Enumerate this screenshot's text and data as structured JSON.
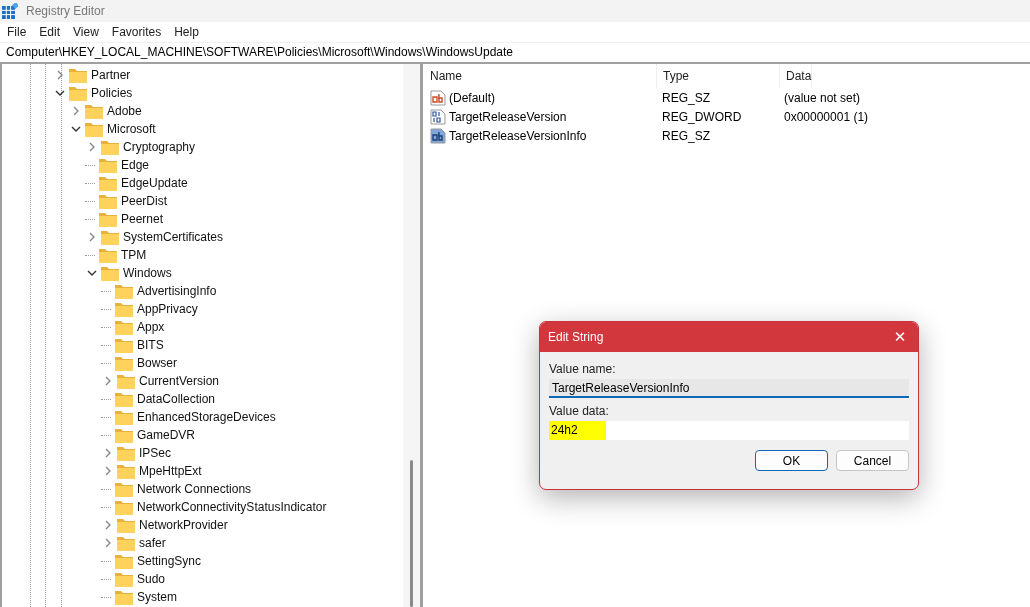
{
  "window": {
    "title": "Registry Editor"
  },
  "menu": [
    "File",
    "Edit",
    "View",
    "Favorites",
    "Help"
  ],
  "address": "Computer\\HKEY_LOCAL_MACHINE\\SOFTWARE\\Policies\\Microsoft\\Windows\\WindowsUpdate",
  "tree": [
    {
      "label": "Partner",
      "expanded": false
    },
    {
      "label": "Policies",
      "expanded": true,
      "children": [
        {
          "label": "Adobe",
          "expanded": false
        },
        {
          "label": "Microsoft",
          "expanded": true,
          "children": [
            {
              "label": "Cryptography",
              "expanded": false
            },
            {
              "label": "Edge"
            },
            {
              "label": "EdgeUpdate"
            },
            {
              "label": "PeerDist"
            },
            {
              "label": "Peernet"
            },
            {
              "label": "SystemCertificates",
              "expanded": false
            },
            {
              "label": "TPM"
            },
            {
              "label": "Windows",
              "expanded": true,
              "children": [
                {
                  "label": "AdvertisingInfo"
                },
                {
                  "label": "AppPrivacy"
                },
                {
                  "label": "Appx"
                },
                {
                  "label": "BITS"
                },
                {
                  "label": "Bowser"
                },
                {
                  "label": "CurrentVersion",
                  "expanded": false
                },
                {
                  "label": "DataCollection"
                },
                {
                  "label": "EnhancedStorageDevices"
                },
                {
                  "label": "GameDVR"
                },
                {
                  "label": "IPSec",
                  "expanded": false
                },
                {
                  "label": "MpeHttpExt",
                  "expanded": false
                },
                {
                  "label": "Network Connections"
                },
                {
                  "label": "NetworkConnectivityStatusIndicator"
                },
                {
                  "label": "NetworkProvider",
                  "expanded": false
                },
                {
                  "label": "safer",
                  "expanded": false
                },
                {
                  "label": "SettingSync"
                },
                {
                  "label": "Sudo"
                },
                {
                  "label": "System"
                }
              ]
            }
          ]
        }
      ]
    }
  ],
  "values": {
    "columns": [
      "Name",
      "Type",
      "Data"
    ],
    "rows": [
      {
        "kind": "string",
        "name": "(Default)",
        "type": "REG_SZ",
        "data": "(value not set)"
      },
      {
        "kind": "dword",
        "name": "TargetReleaseVersion",
        "type": "REG_DWORD",
        "data": "0x00000001 (1)"
      },
      {
        "kind": "string_selected",
        "name": "TargetReleaseVersionInfo",
        "type": "REG_SZ"
      }
    ]
  },
  "dialog": {
    "title": "Edit String",
    "close": "✕",
    "value_name_label": "Value name:",
    "value_name": "TargetReleaseVersionInfo",
    "value_data_label": "Value data:",
    "value_data": "24h2",
    "value_data_highlighted": true,
    "buttons": [
      "OK",
      "Cancel"
    ]
  }
}
